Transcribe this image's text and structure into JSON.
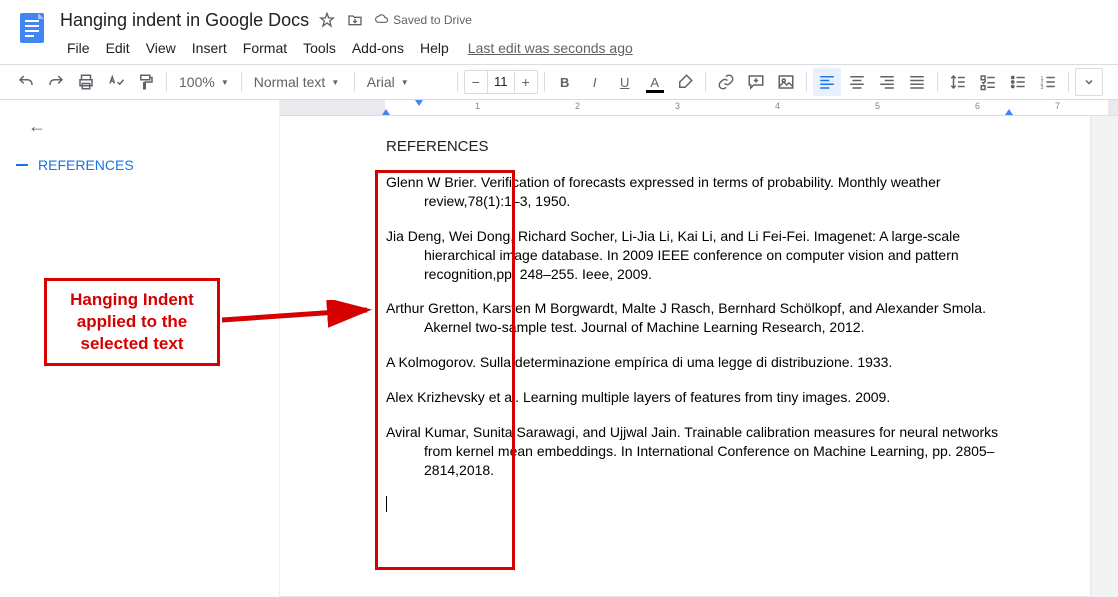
{
  "header": {
    "doc_title": "Hanging indent in Google Docs",
    "saved_label": "Saved to Drive",
    "last_edit": "Last edit was seconds ago"
  },
  "menus": [
    "File",
    "Edit",
    "View",
    "Insert",
    "Format",
    "Tools",
    "Add-ons",
    "Help"
  ],
  "toolbar": {
    "zoom": "100%",
    "style": "Normal text",
    "font": "Arial",
    "font_size": "11"
  },
  "outline": {
    "item": "REFERENCES"
  },
  "callout": {
    "line1": "Hanging Indent",
    "line2": "applied to the",
    "line3": "selected text"
  },
  "document": {
    "heading": "REFERENCES",
    "refs": [
      "Glenn W Brier. Verification of forecasts expressed in terms of probability. Monthly weather review,78(1):1–3, 1950.",
      "Jia Deng, Wei Dong, Richard Socher, Li-Jia Li, Kai Li, and Li Fei-Fei. Imagenet: A large-scale hierarchical image database. In 2009 IEEE conference on computer vision and pattern recognition,pp. 248–255. Ieee, 2009.",
      "Arthur Gretton, Karsten M Borgwardt, Malte J Rasch, Bernhard Schölkopf, and Alexander Smola. Akernel two-sample test. Journal of Machine Learning Research, 2012.",
      "A Kolmogorov. Sulla determinazione empírica di uma legge di distribuzione. 1933.",
      "Alex Krizhevsky et al. Learning multiple layers of features from tiny images. 2009.",
      "Aviral Kumar, Sunita Sarawagi, and Ujjwal Jain. Trainable calibration measures for neural networks from kernel mean embeddings. In International Conference on Machine Learning, pp. 2805–2814,2018."
    ]
  },
  "ruler_numbers": [
    "1",
    "2",
    "3",
    "4",
    "5",
    "6",
    "7"
  ]
}
